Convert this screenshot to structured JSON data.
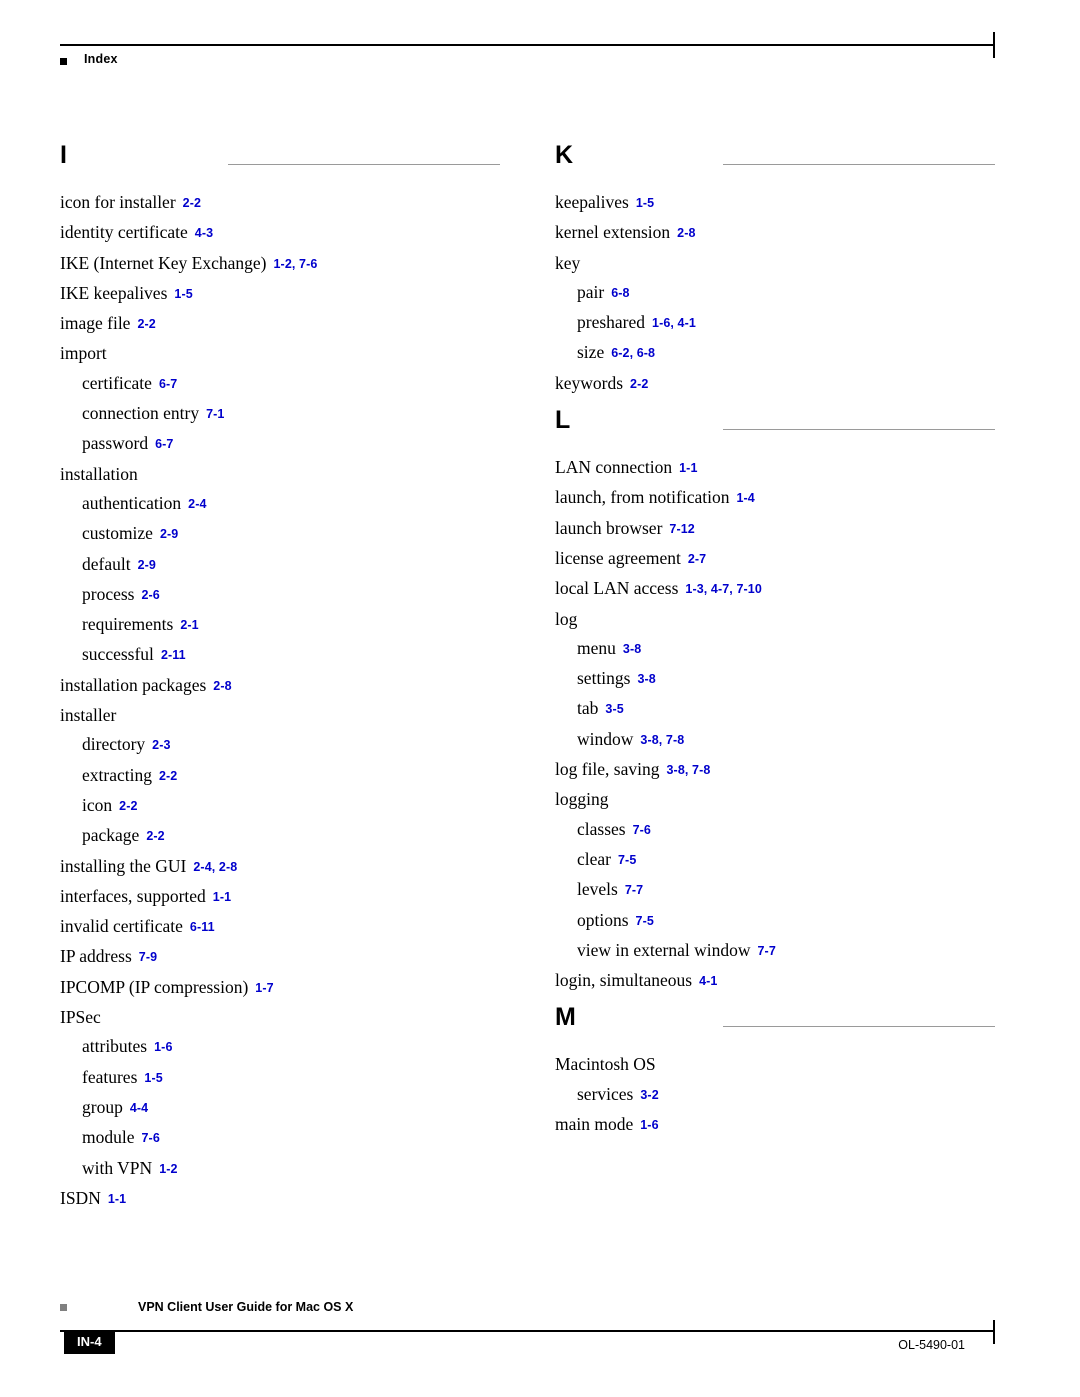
{
  "header": {
    "title": "Index"
  },
  "footer": {
    "guide_title": "VPN Client User Guide for Mac OS X",
    "page_number": "IN-4",
    "doc_id": "OL-5490-01"
  },
  "columns": {
    "left": [
      {
        "letter": "I",
        "entries": [
          {
            "level": 1,
            "text": "icon for installer",
            "ref": "2-2"
          },
          {
            "level": 1,
            "text": "identity certificate",
            "ref": "4-3"
          },
          {
            "level": 1,
            "text": "IKE (Internet Key Exchange)",
            "ref": "1-2, 7-6"
          },
          {
            "level": 1,
            "text": "IKE keepalives",
            "ref": "1-5"
          },
          {
            "level": 1,
            "text": "image file",
            "ref": "2-2"
          },
          {
            "level": 1,
            "text": "import",
            "ref": ""
          },
          {
            "level": 2,
            "text": "certificate",
            "ref": "6-7"
          },
          {
            "level": 2,
            "text": "connection entry",
            "ref": "7-1"
          },
          {
            "level": 2,
            "text": "password",
            "ref": "6-7"
          },
          {
            "level": 1,
            "text": "installation",
            "ref": ""
          },
          {
            "level": 2,
            "text": "authentication",
            "ref": "2-4"
          },
          {
            "level": 2,
            "text": "customize",
            "ref": "2-9"
          },
          {
            "level": 2,
            "text": "default",
            "ref": "2-9"
          },
          {
            "level": 2,
            "text": "process",
            "ref": "2-6"
          },
          {
            "level": 2,
            "text": "requirements",
            "ref": "2-1"
          },
          {
            "level": 2,
            "text": "successful",
            "ref": "2-11"
          },
          {
            "level": 1,
            "text": "installation packages",
            "ref": "2-8"
          },
          {
            "level": 1,
            "text": "installer",
            "ref": ""
          },
          {
            "level": 2,
            "text": "directory",
            "ref": "2-3"
          },
          {
            "level": 2,
            "text": "extracting",
            "ref": "2-2"
          },
          {
            "level": 2,
            "text": "icon",
            "ref": "2-2"
          },
          {
            "level": 2,
            "text": "package",
            "ref": "2-2"
          },
          {
            "level": 1,
            "text": "installing the GUI",
            "ref": "2-4, 2-8"
          },
          {
            "level": 1,
            "text": "interfaces, supported",
            "ref": "1-1"
          },
          {
            "level": 1,
            "text": "invalid certificate",
            "ref": "6-11"
          },
          {
            "level": 1,
            "text": "IP address",
            "ref": "7-9"
          },
          {
            "level": 1,
            "text": "IPCOMP (IP compression)",
            "ref": "1-7"
          },
          {
            "level": 1,
            "text": "IPSec",
            "ref": ""
          },
          {
            "level": 2,
            "text": "attributes",
            "ref": "1-6"
          },
          {
            "level": 2,
            "text": "features",
            "ref": "1-5"
          },
          {
            "level": 2,
            "text": "group",
            "ref": "4-4"
          },
          {
            "level": 2,
            "text": "module",
            "ref": "7-6"
          },
          {
            "level": 2,
            "text": "with VPN",
            "ref": "1-2"
          },
          {
            "level": 1,
            "text": "ISDN",
            "ref": "1-1"
          }
        ]
      }
    ],
    "right": [
      {
        "letter": "K",
        "entries": [
          {
            "level": 1,
            "text": "keepalives",
            "ref": "1-5"
          },
          {
            "level": 1,
            "text": "kernel extension",
            "ref": "2-8"
          },
          {
            "level": 1,
            "text": "key",
            "ref": ""
          },
          {
            "level": 2,
            "text": "pair",
            "ref": "6-8"
          },
          {
            "level": 2,
            "text": "preshared",
            "ref": "1-6, 4-1"
          },
          {
            "level": 2,
            "text": "size",
            "ref": "6-2, 6-8"
          },
          {
            "level": 1,
            "text": "keywords",
            "ref": "2-2"
          }
        ]
      },
      {
        "letter": "L",
        "entries": [
          {
            "level": 1,
            "text": "LAN connection",
            "ref": "1-1"
          },
          {
            "level": 1,
            "text": "launch, from notification",
            "ref": "1-4"
          },
          {
            "level": 1,
            "text": "launch browser",
            "ref": "7-12"
          },
          {
            "level": 1,
            "text": "license agreement",
            "ref": "2-7"
          },
          {
            "level": 1,
            "text": "local LAN access",
            "ref": "1-3, 4-7, 7-10"
          },
          {
            "level": 1,
            "text": "log",
            "ref": ""
          },
          {
            "level": 2,
            "text": "menu",
            "ref": "3-8"
          },
          {
            "level": 2,
            "text": "settings",
            "ref": "3-8"
          },
          {
            "level": 2,
            "text": "tab",
            "ref": "3-5"
          },
          {
            "level": 2,
            "text": "window",
            "ref": "3-8, 7-8"
          },
          {
            "level": 1,
            "text": "log file, saving",
            "ref": "3-8, 7-8"
          },
          {
            "level": 1,
            "text": "logging",
            "ref": ""
          },
          {
            "level": 2,
            "text": "classes",
            "ref": "7-6"
          },
          {
            "level": 2,
            "text": "clear",
            "ref": "7-5"
          },
          {
            "level": 2,
            "text": "levels",
            "ref": "7-7"
          },
          {
            "level": 2,
            "text": "options",
            "ref": "7-5"
          },
          {
            "level": 2,
            "text": "view in external window",
            "ref": "7-7"
          },
          {
            "level": 1,
            "text": "login, simultaneous",
            "ref": "4-1"
          }
        ]
      },
      {
        "letter": "M",
        "entries": [
          {
            "level": 1,
            "text": "Macintosh OS",
            "ref": ""
          },
          {
            "level": 2,
            "text": "services",
            "ref": "3-2"
          },
          {
            "level": 1,
            "text": "main mode",
            "ref": "1-6"
          }
        ]
      }
    ]
  }
}
